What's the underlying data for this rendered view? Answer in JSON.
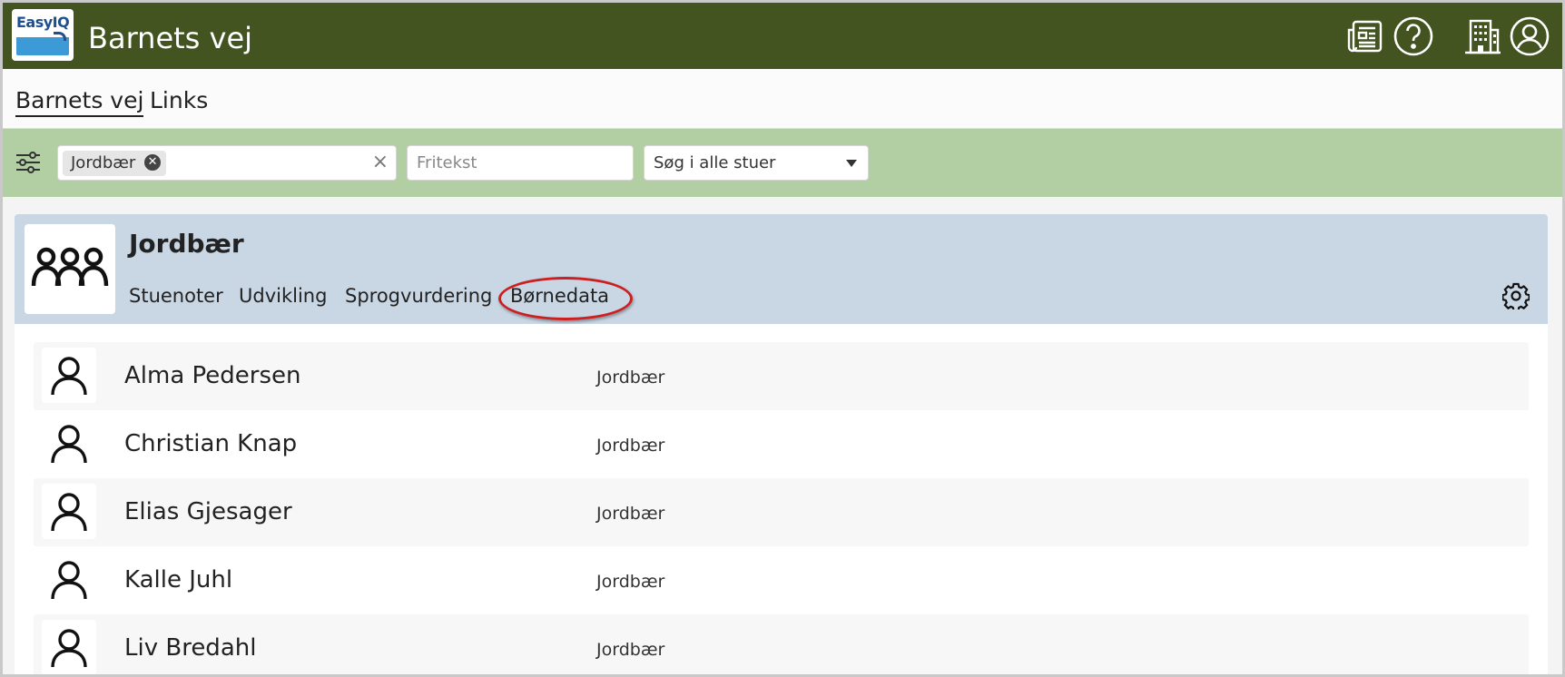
{
  "app": {
    "logo_text": "EasyIQ",
    "title": "Barnets vej",
    "icons": [
      "news-icon",
      "help-icon",
      "building-icon",
      "user-account-icon"
    ]
  },
  "nav": {
    "tabs": [
      {
        "label": "Barnets vej",
        "active": true
      },
      {
        "label": "Links",
        "active": false
      }
    ]
  },
  "filters": {
    "chip_label": "Jordbær",
    "clear_symbol": "×",
    "freetext_placeholder": "Fritekst",
    "room_select_value": "Søg i alle stuer"
  },
  "group": {
    "name": "Jordbær",
    "tabs": [
      "Stuenoter",
      "Udvikling",
      "Sprogvurdering",
      "Børnedata"
    ],
    "highlighted_tab": "Børnedata",
    "annotation_color": "#cc1f1f"
  },
  "children": [
    {
      "name": "Alma Pedersen",
      "group": "Jordbær"
    },
    {
      "name": "Christian Knap",
      "group": "Jordbær"
    },
    {
      "name": "Elias Gjesager",
      "group": "Jordbær"
    },
    {
      "name": "Kalle Juhl",
      "group": "Jordbær"
    },
    {
      "name": "Liv Bredahl",
      "group": "Jordbær"
    }
  ],
  "colors": {
    "topbar": "#435420",
    "filterbar": "#b1cfa3",
    "group_header": "#c9d7e5"
  }
}
